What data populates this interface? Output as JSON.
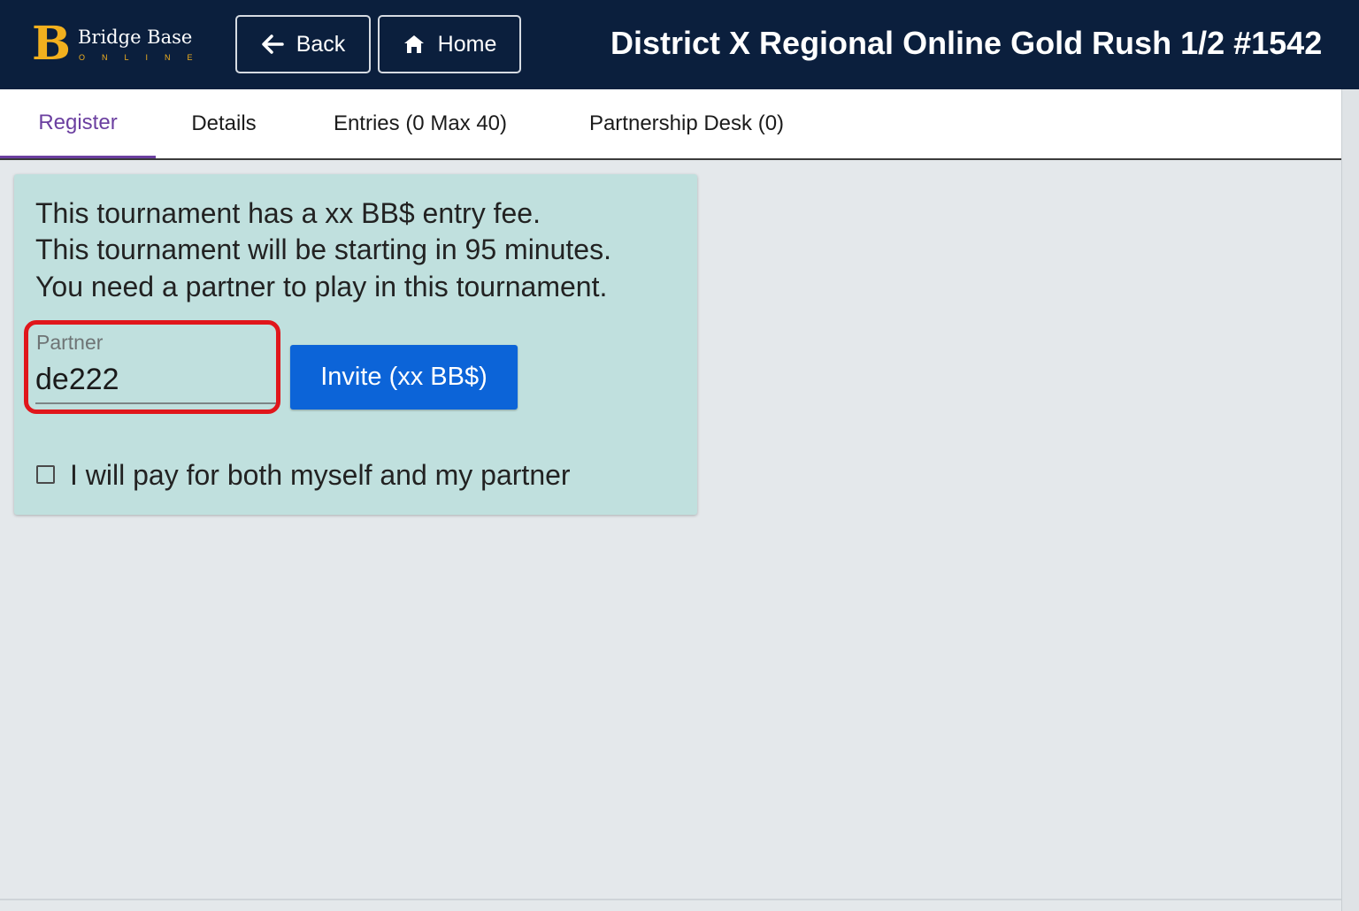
{
  "header": {
    "logo_name": "Bridge Base",
    "logo_sub": "ONLINE",
    "back_label": "Back",
    "home_label": "Home",
    "title": "District X Regional Online Gold Rush 1/2 #1542"
  },
  "tabs": [
    {
      "label": "Register",
      "active": true
    },
    {
      "label": "Details"
    },
    {
      "label": "Entries (0 Max 40)"
    },
    {
      "label": "Partnership Desk (0)"
    }
  ],
  "register": {
    "line1": "This tournament has a xx BB$ entry fee.",
    "line2": "This tournament will be starting in 95 minutes.",
    "line3": "You need a partner to play in this tournament.",
    "partner_label": "Partner",
    "partner_value": "de222",
    "invite_label": "Invite (xx BB$)",
    "pay_both_label": "I will pay for both myself and my partner",
    "pay_both_checked": false
  },
  "colors": {
    "header_bg": "#0b1f3d",
    "logo_accent": "#f2b01e",
    "active_tab": "#6b3fa0",
    "card_bg": "#c0e0de",
    "invite_bg": "#0c64d8",
    "highlight": "#e0161b"
  }
}
